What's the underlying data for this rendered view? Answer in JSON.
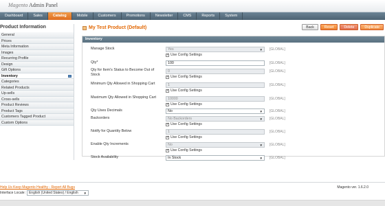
{
  "app": {
    "logo_brand": "Magento",
    "logo_rest": " Admin Panel"
  },
  "nav": [
    {
      "label": "Dashboard",
      "active": false
    },
    {
      "label": "Sales",
      "active": false
    },
    {
      "label": "Catalog",
      "active": true
    },
    {
      "label": "Mobile",
      "active": false
    },
    {
      "label": "Customers",
      "active": false
    },
    {
      "label": "Promotions",
      "active": false
    },
    {
      "label": "Newsletter",
      "active": false
    },
    {
      "label": "CMS",
      "active": false
    },
    {
      "label": "Reports",
      "active": false
    },
    {
      "label": "System",
      "active": false
    }
  ],
  "sidebar": {
    "title": "Product Information",
    "items": [
      {
        "label": "General"
      },
      {
        "label": "Prices"
      },
      {
        "label": "Meta Information"
      },
      {
        "label": "Images"
      },
      {
        "label": "Recurring Profile"
      },
      {
        "label": "Design"
      },
      {
        "label": "Gift Options"
      },
      {
        "label": "Inventory",
        "active": true
      },
      {
        "label": "Categories"
      },
      {
        "label": "Related Products"
      },
      {
        "label": "Up-sells"
      },
      {
        "label": "Cross-sells"
      },
      {
        "label": "Product Reviews"
      },
      {
        "label": "Product Tags"
      },
      {
        "label": "Customers Tagged Product"
      },
      {
        "label": "Custom Options"
      }
    ]
  },
  "product": {
    "title": "My Test Product (Default)"
  },
  "buttons": {
    "back": "Back",
    "reset": "Reset",
    "delete": "Delete",
    "duplicate": "Duplicate"
  },
  "inventory": {
    "section_title": "Inventory",
    "use_config_label": "Use Config Settings",
    "scope": "[GLOBAL]",
    "rows": {
      "manage_stock": {
        "label": "Manage Stock",
        "value": "Yes"
      },
      "qty": {
        "label": "Qty*",
        "value": "100"
      },
      "out_of_stock": {
        "label": "Qty for Item's Status to Become Out of Stock",
        "value": "0"
      },
      "min_qty": {
        "label": "Minimum Qty Allowed in Shopping Cart",
        "value": "1"
      },
      "max_qty": {
        "label": "Maximum Qty Allowed in Shopping Cart",
        "value": "10000"
      },
      "qty_decimals": {
        "label": "Qty Uses Decimals",
        "value": "No"
      },
      "backorders": {
        "label": "Backorders",
        "value": "No Backorders"
      },
      "notify_below": {
        "label": "Notify for Quantity Below",
        "value": "1"
      },
      "qty_increments": {
        "label": "Enable Qty Increments",
        "value": "No"
      },
      "availability": {
        "label": "Stock Availability",
        "value": "In Stock"
      }
    }
  },
  "footer": {
    "help_link": "Help Us Keep Magento Healthy - Report All Bugs",
    "locale_label": "Interface Locale:",
    "locale_value": "English (United States) / English",
    "version": "Magento ver. 1.6.2.0"
  },
  "colors": {
    "accent": "#e26703",
    "nav_bg": "#5a7180",
    "section_head": "#6f8797"
  }
}
